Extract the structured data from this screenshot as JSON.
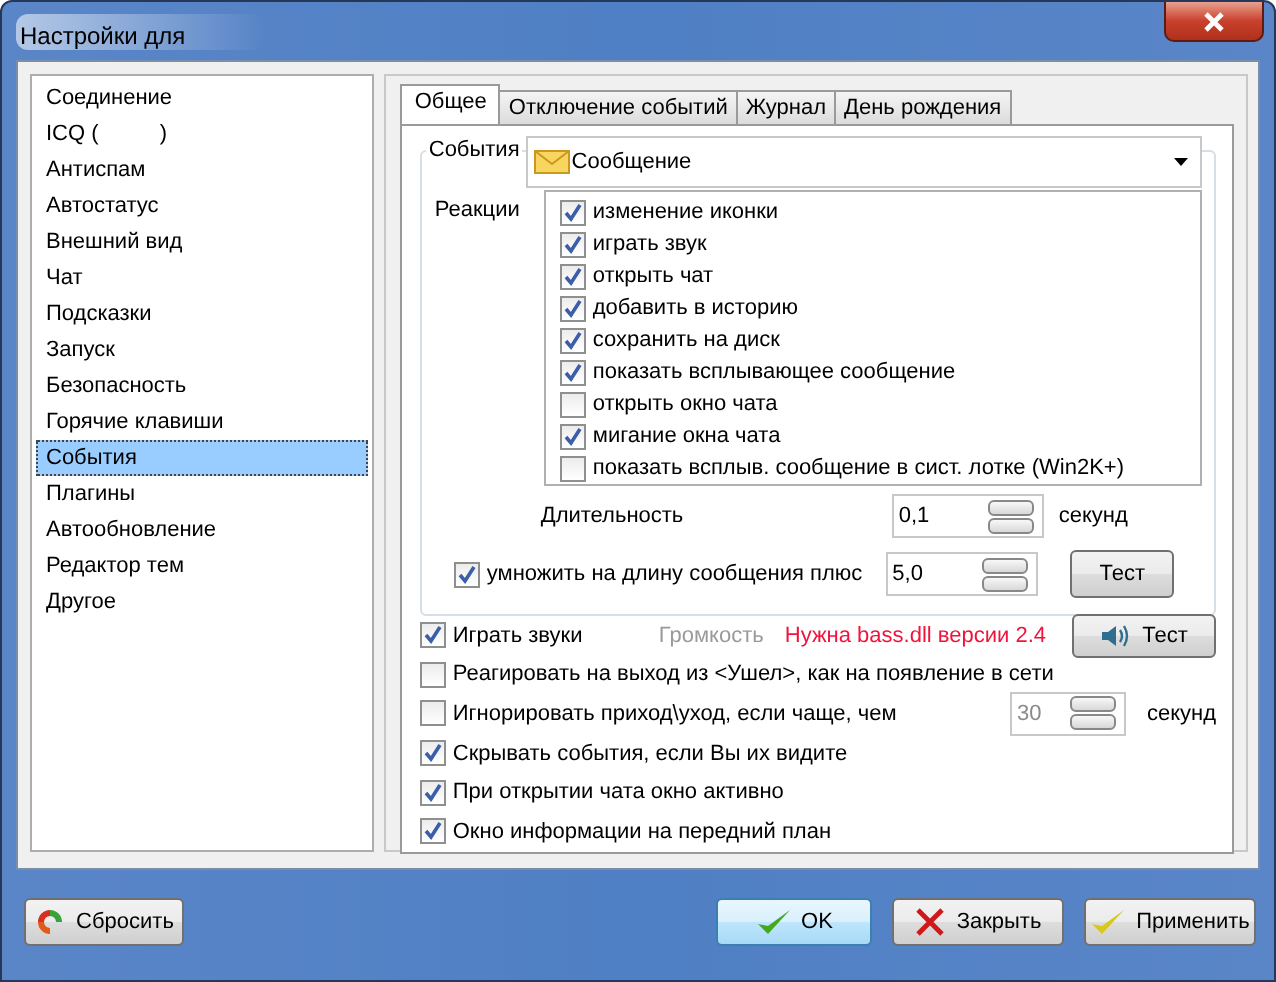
{
  "window": {
    "title": "Настройки для"
  },
  "sidebar": {
    "items": [
      {
        "label": "Соединение",
        "selected": false
      },
      {
        "label": "ICQ (          )",
        "selected": false
      },
      {
        "label": "Антиспам",
        "selected": false
      },
      {
        "label": "Автостатус",
        "selected": false
      },
      {
        "label": "Внешний вид",
        "selected": false
      },
      {
        "label": "Чат",
        "selected": false
      },
      {
        "label": "Подсказки",
        "selected": false
      },
      {
        "label": "Запуск",
        "selected": false
      },
      {
        "label": "Безопасность",
        "selected": false
      },
      {
        "label": "Горячие клавиши",
        "selected": false
      },
      {
        "label": "События",
        "selected": true
      },
      {
        "label": "Плагины",
        "selected": false
      },
      {
        "label": "Автообновление",
        "selected": false
      },
      {
        "label": "Редактор тем",
        "selected": false
      },
      {
        "label": "Другое",
        "selected": false
      }
    ]
  },
  "tabs": [
    {
      "label": "Общее",
      "selected": true
    },
    {
      "label": "Отключение событий",
      "selected": false
    },
    {
      "label": "Журнал",
      "selected": false
    },
    {
      "label": "День рождения",
      "selected": false
    }
  ],
  "events": {
    "label": "События",
    "value": "Сообщение"
  },
  "reactions": {
    "label": "Реакции",
    "items": [
      {
        "label": "изменение иконки",
        "checked": true
      },
      {
        "label": "играть звук",
        "checked": true
      },
      {
        "label": "открыть чат",
        "checked": true
      },
      {
        "label": "добавить в историю",
        "checked": true
      },
      {
        "label": "сохранить на диск",
        "checked": true
      },
      {
        "label": "показать всплывающее сообщение",
        "checked": true
      },
      {
        "label": "открыть окно чата",
        "checked": false
      },
      {
        "label": "мигание окна чата",
        "checked": true
      },
      {
        "label": "показать всплыв. сообщение в сист. лотке (Win2K+)",
        "checked": false
      }
    ]
  },
  "duration": {
    "label": "Длительность",
    "value": "0,1",
    "unit": "секунд"
  },
  "multiply": {
    "label": "умножить на длину сообщения плюс",
    "checked": true,
    "value": "5,0",
    "button": "Тест"
  },
  "options": [
    {
      "kind": "sound",
      "label": "Играть звуки",
      "checked": true,
      "volume": "Громкость",
      "warning": "Нужна bass.dll версии 2.4",
      "button": "Тест"
    },
    {
      "kind": "plain",
      "label": "Реагировать на выход из <Ушел>, как на появление в сети",
      "checked": false
    },
    {
      "kind": "interval",
      "label": "Игнорировать приход\\уход, если чаще, чем",
      "checked": false,
      "value": "30",
      "unit": "секунд",
      "disabled": true
    },
    {
      "kind": "plain",
      "label": "Скрывать события, если Вы их видите",
      "checked": true
    },
    {
      "kind": "plain",
      "label": "При открытии чата окно активно",
      "checked": true
    },
    {
      "kind": "plain",
      "label": "Окно информации на передний план",
      "checked": true
    }
  ],
  "buttons": [
    {
      "kind": "reset",
      "label": "Сбросить"
    },
    {
      "kind": "ok",
      "label": "OK"
    },
    {
      "kind": "close",
      "label": "Закрыть"
    },
    {
      "kind": "apply",
      "label": "Применить"
    }
  ]
}
